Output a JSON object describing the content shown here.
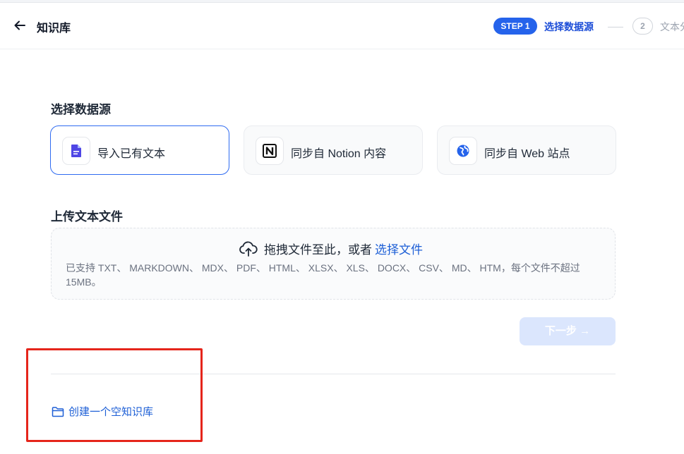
{
  "header": {
    "title": "知识库",
    "steps": [
      {
        "badge": "STEP 1",
        "label": "选择数据源",
        "active": true
      },
      {
        "badge": "2",
        "label": "文本分段",
        "active": false
      }
    ]
  },
  "datasource": {
    "section_title": "选择数据源",
    "options": [
      {
        "label": "导入已有文本",
        "icon": "file-text-icon",
        "selected": true
      },
      {
        "label": "同步自 Notion 内容",
        "icon": "notion-icon",
        "selected": false
      },
      {
        "label": "同步自 Web 站点",
        "icon": "globe-icon",
        "selected": false
      }
    ]
  },
  "upload": {
    "section_title": "上传文本文件",
    "drop_text": "拖拽文件至此，或者",
    "select_link": "选择文件",
    "support_text": "已支持 TXT、 MARKDOWN、 MDX、 PDF、 HTML、 XLSX、 XLS、 DOCX、 CSV、 MD、 HTM，每个文件不超过 15MB。"
  },
  "next_button": {
    "label": "下一步 →",
    "disabled": true
  },
  "create_empty": {
    "label": "创建一个空知识库"
  },
  "colors": {
    "accent": "#2563eb",
    "highlight_box": "#e5251b"
  }
}
